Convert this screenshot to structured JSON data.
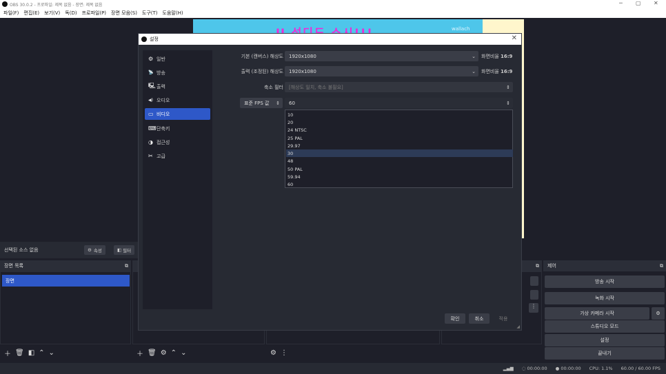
{
  "titlebar": {
    "title": "OBS 30.0.2 - 프로파일: 제목 없음 - 장면: 제목 없음",
    "min": "─",
    "max": "▢",
    "close": "✕"
  },
  "menu": [
    "파일(F)",
    "편집(E)",
    "보기(V)",
    "독(D)",
    "프로파일(P)",
    "장면 모음(S)",
    "도구(T)",
    "도움말(H)"
  ],
  "canvas": {
    "banner_text": "U 성디도 소시!!!",
    "watermark": "wallach"
  },
  "source_bar": {
    "label": "선택된 소스 없음",
    "props_btn": "속성",
    "filter_btn": "필터"
  },
  "scenes": {
    "header": "장면 목록",
    "items": [
      "장면"
    ]
  },
  "controls": {
    "header": "제어",
    "buttons": [
      "방송 시작",
      "녹화 시작",
      "가상 카메라 시작",
      "스튜디오 모드",
      "설정",
      "끝내기"
    ]
  },
  "status": {
    "stream_time": "00:00:00",
    "rec_time": "00:00:00",
    "cpu": "CPU: 1.1%",
    "fps": "60.00 / 60.00 FPS"
  },
  "dialog": {
    "title": "설정",
    "sidebar": [
      {
        "label": "일반",
        "icon": "⚙"
      },
      {
        "label": "방송",
        "icon": "📡"
      },
      {
        "label": "출력",
        "icon": "🖳"
      },
      {
        "label": "오디오",
        "icon": "◀)"
      },
      {
        "label": "비디오",
        "icon": "▭"
      },
      {
        "label": "단축키",
        "icon": "⌨"
      },
      {
        "label": "접근성",
        "icon": "◑"
      },
      {
        "label": "고급",
        "icon": "✂"
      }
    ],
    "base_res_label": "기본 (캔버스) 해상도",
    "base_res_value": "1920x1080",
    "base_aspect": "화면비율",
    "base_aspect_val": "16:9",
    "out_res_label": "출력 (조정된) 해상도",
    "out_res_value": "1920x1080",
    "out_aspect": "화면비율",
    "out_aspect_val": "16:9",
    "filter_label": "축소 필터",
    "filter_value": "[해상도 일치, 축소 불필요]",
    "fps_type": "표준 FPS 값",
    "fps_value": "60",
    "fps_options": [
      "10",
      "20",
      "24 NTSC",
      "25 PAL",
      "29.97",
      "30",
      "48",
      "50 PAL",
      "59.94",
      "60"
    ],
    "fps_highlight": "30",
    "ok": "확인",
    "cancel": "취소",
    "apply": "적용"
  },
  "colors": {
    "accent": "#2e58c8",
    "bg": "#1e1f29",
    "panel": "#272a33",
    "button": "#3a3d47"
  }
}
